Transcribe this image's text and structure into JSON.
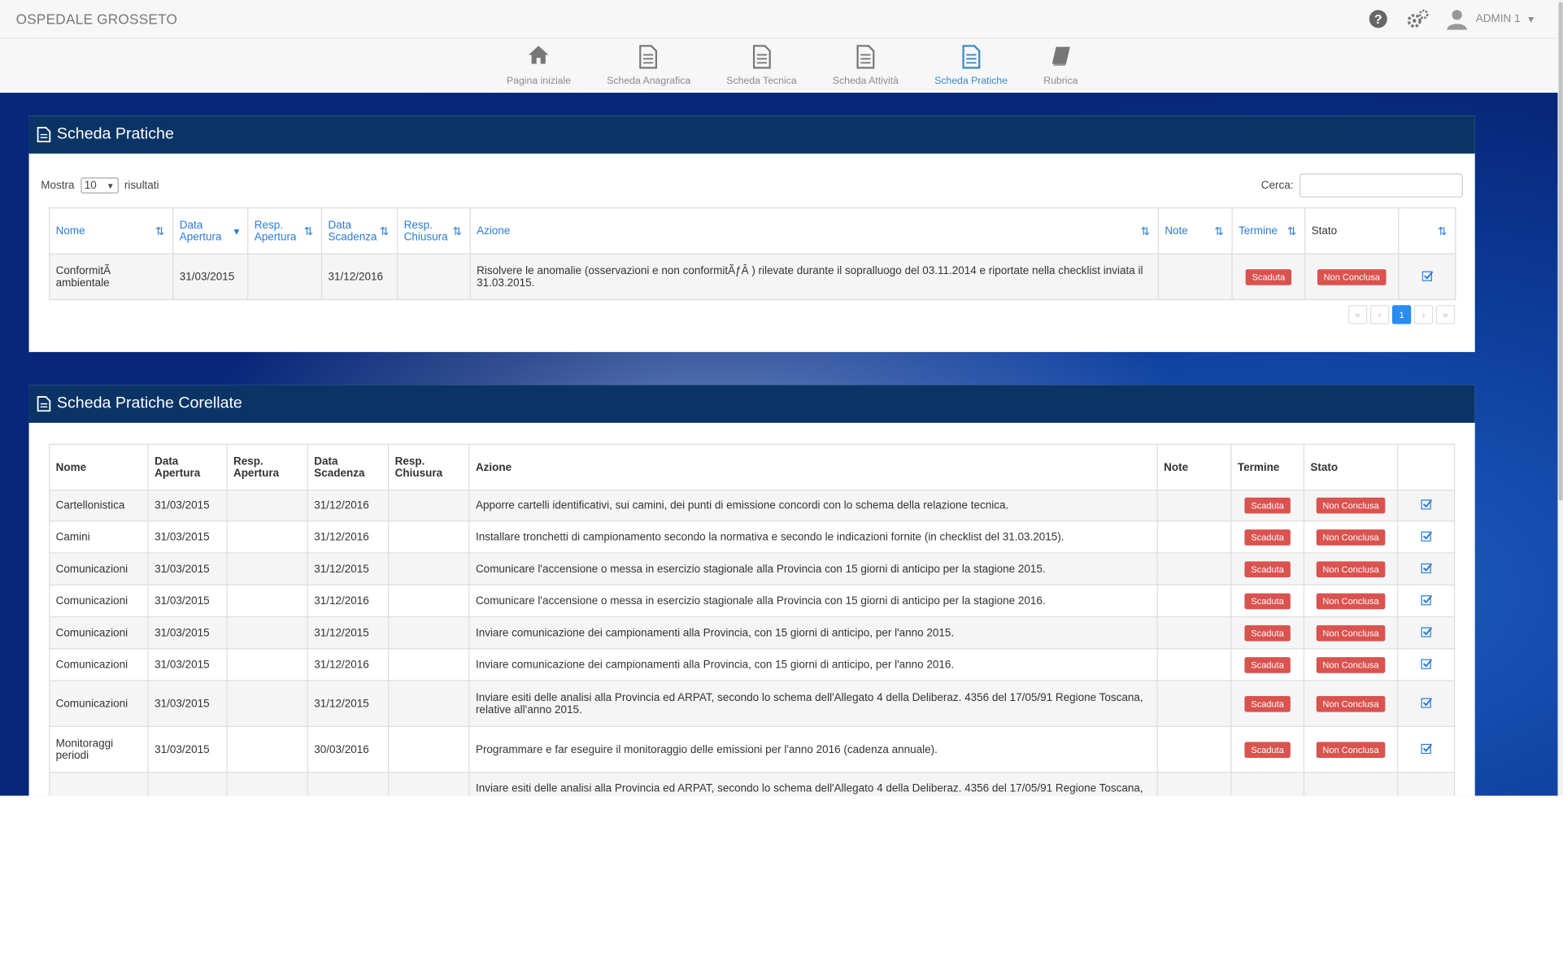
{
  "app": {
    "title": "OSPEDALE GROSSETO",
    "user": "ADMIN 1"
  },
  "nav": [
    {
      "label": "Pagina iniziale",
      "icon": "home-icon"
    },
    {
      "label": "Scheda Anagrafica",
      "icon": "document-icon"
    },
    {
      "label": "Scheda Tecnica",
      "icon": "document-icon"
    },
    {
      "label": "Scheda Attività",
      "icon": "document-icon"
    },
    {
      "label": "Scheda Pratiche",
      "icon": "document-icon"
    },
    {
      "label": "Rubrica",
      "icon": "book-icon"
    }
  ],
  "panel1": {
    "title": "Scheda Pratiche",
    "mostra": "Mostra",
    "page_size": "10",
    "risultati": "risultati",
    "cerca": "Cerca:",
    "headers": [
      "Nome",
      "Data Apertura",
      "Resp. Apertura",
      "Data Scadenza",
      "Resp. Chiusura",
      "Azione",
      "Note",
      "Termine",
      "Stato",
      ""
    ],
    "rows": [
      [
        "ConformitÃ ambientale",
        "31/03/2015",
        "",
        "31/12/2016",
        "",
        "Risolvere le anomalie (osservazioni e non conformitÃƒÂ ) rilevate durante il sopralluogo del 03.11.2014 e riportate nella checklist inviata il 31.03.2015.",
        "",
        "Scaduta",
        "Non Conclusa"
      ]
    ],
    "pager": [
      "«",
      "‹",
      "1",
      "›",
      "»"
    ]
  },
  "panel2": {
    "title": "Scheda Pratiche Corellate",
    "headers": [
      "Nome",
      "Data Apertura",
      "Resp. Apertura",
      "Data Scadenza",
      "Resp. Chiusura",
      "Azione",
      "Note",
      "Termine",
      "Stato",
      ""
    ],
    "rows": [
      [
        "Cartellonistica",
        "31/03/2015",
        "",
        "31/12/2016",
        "",
        "Apporre cartelli identificativi, sui camini, dei punti di emissione concordi con lo schema della relazione tecnica.",
        "",
        "Scaduta",
        "Non Conclusa"
      ],
      [
        "Camini",
        "31/03/2015",
        "",
        "31/12/2016",
        "",
        "Installare tronchetti di campionamento secondo la normativa e secondo le indicazioni fornite (in checklist del 31.03.2015).",
        "",
        "Scaduta",
        "Non Conclusa"
      ],
      [
        "Comunicazioni",
        "31/03/2015",
        "",
        "31/12/2015",
        "",
        "Comunicare l'accensione o messa in esercizio stagionale alla Provincia con 15 giorni di anticipo per la stagione 2015.",
        "",
        "Scaduta",
        "Non Conclusa"
      ],
      [
        "Comunicazioni",
        "31/03/2015",
        "",
        "31/12/2016",
        "",
        "Comunicare l'accensione o messa in esercizio stagionale alla Provincia con 15 giorni di anticipo per la stagione 2016.",
        "",
        "Scaduta",
        "Non Conclusa"
      ],
      [
        "Comunicazioni",
        "31/03/2015",
        "",
        "31/12/2015",
        "",
        "Inviare comunicazione dei campionamenti alla Provincia, con 15 giorni di anticipo, per l'anno 2015.",
        "",
        "Scaduta",
        "Non Conclusa"
      ],
      [
        "Comunicazioni",
        "31/03/2015",
        "",
        "31/12/2016",
        "",
        "Inviare comunicazione dei campionamenti alla Provincia, con 15 giorni di anticipo, per l'anno 2016.",
        "",
        "Scaduta",
        "Non Conclusa"
      ],
      [
        "Comunicazioni",
        "31/03/2015",
        "",
        "31/12/2015",
        "",
        "Inviare esiti delle analisi alla Provincia ed ARPAT, secondo lo schema dell'Allegato 4 della Deliberaz. 4356 del 17/05/91 Regione Toscana, relative all'anno 2015.",
        "",
        "Scaduta",
        "Non Conclusa"
      ],
      [
        "Monitoraggi periodi",
        "31/03/2015",
        "",
        "30/03/2016",
        "",
        "Programmare e far eseguire il monitoraggio delle emissioni per l'anno 2016 (cadenza annuale).",
        "",
        "Scaduta",
        "Non Conclusa"
      ],
      [
        "",
        "",
        "",
        "",
        "",
        "Inviare esiti delle analisi alla Provincia ed ARPAT, secondo lo schema dell'Allegato 4 della Deliberaz. 4356 del 17/05/91 Regione Toscana,",
        "",
        "",
        ""
      ]
    ]
  },
  "colors": {
    "header": "#0a3466",
    "accent": "#2a7bd8",
    "badge": "#d9534f"
  }
}
